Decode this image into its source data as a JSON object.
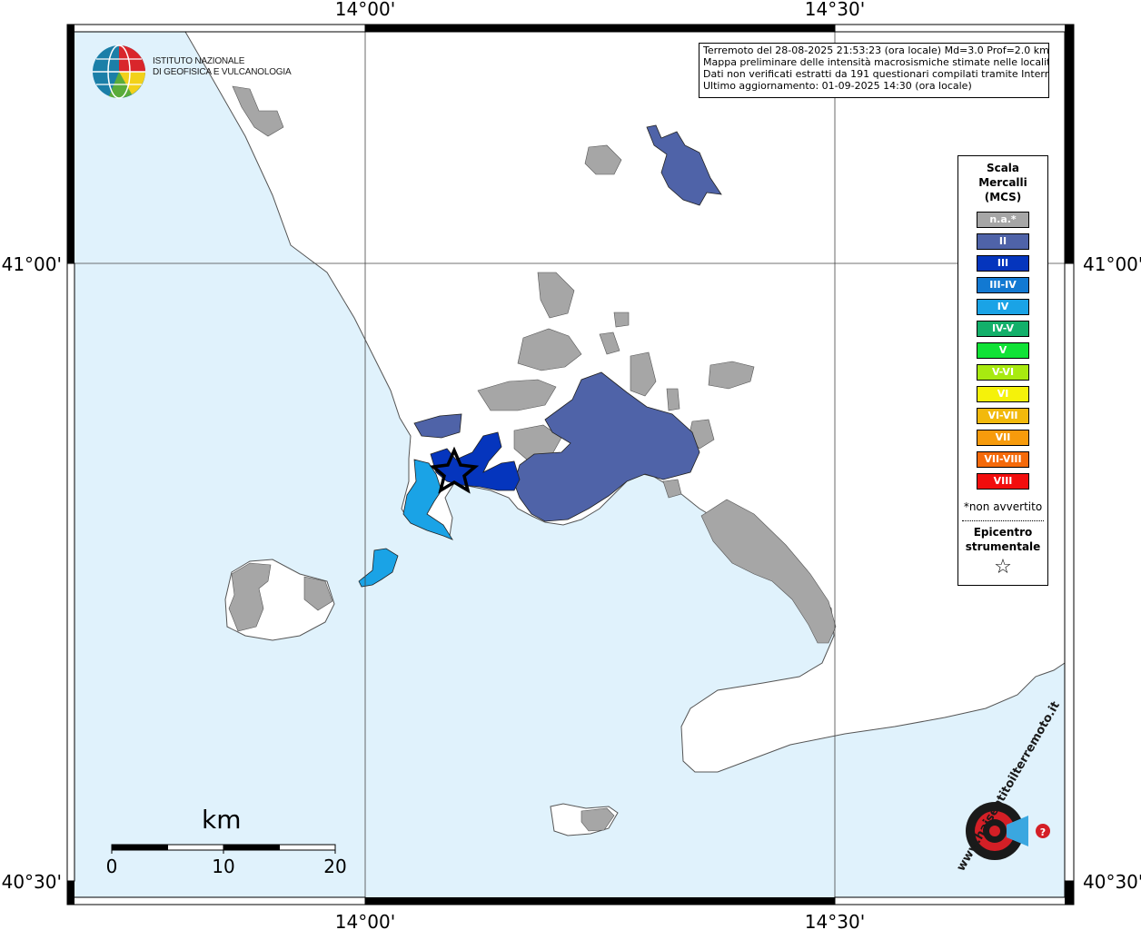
{
  "map": {
    "lon_labels": [
      "14°00'",
      "14°30'"
    ],
    "lat_labels": [
      "41°00'",
      "40°30'"
    ],
    "sea_color": "#e0f2fc",
    "land_color": "#ffffff",
    "na_color": "#a6a6a6"
  },
  "institute": {
    "line1": "ISTITUTO NAZIONALE",
    "line2": "DI GEOFISICA E VULCANOLOGIA"
  },
  "info": {
    "line1": "Terremoto del 28-08-2025 21:53:23 (ora locale) Md=3.0 Prof=2.0 km",
    "line2": "Mappa preliminare delle intensità macrosismiche stimate nelle località",
    "line3": "Dati non verificati estratti da 191 questionari compilati tramite Internet.",
    "line4": "Ultimo aggiornamento: 01-09-2025 14:30 (ora locale)"
  },
  "legend": {
    "title1": "Scala",
    "title2": "Mercalli",
    "title3": "(MCS)",
    "items": [
      {
        "label": "n.a.*",
        "color": "#a6a6a6"
      },
      {
        "label": "II",
        "color": "#4f63a8"
      },
      {
        "label": "III",
        "color": "#0535bd"
      },
      {
        "label": "III-IV",
        "color": "#1279d2"
      },
      {
        "label": "IV",
        "color": "#1aa3e6"
      },
      {
        "label": "IV-V",
        "color": "#12b06a"
      },
      {
        "label": "V",
        "color": "#10e236"
      },
      {
        "label": "V-VI",
        "color": "#a8ea10"
      },
      {
        "label": "VI",
        "color": "#f5f20a"
      },
      {
        "label": "VI-VII",
        "color": "#f2b90c"
      },
      {
        "label": "VII",
        "color": "#f79b0c"
      },
      {
        "label": "VII-VIII",
        "color": "#f56a0a"
      },
      {
        "label": "VIII",
        "color": "#f20d0d"
      }
    ],
    "note": "*non avvertito",
    "epi1": "Epicentro",
    "epi2": "strumentale",
    "epi_symbol": "☆"
  },
  "scale_bar": {
    "unit": "km",
    "ticks": [
      "0",
      "10",
      "20"
    ]
  },
  "watermark": {
    "text": "www.haisentitoilterremoto.it"
  }
}
